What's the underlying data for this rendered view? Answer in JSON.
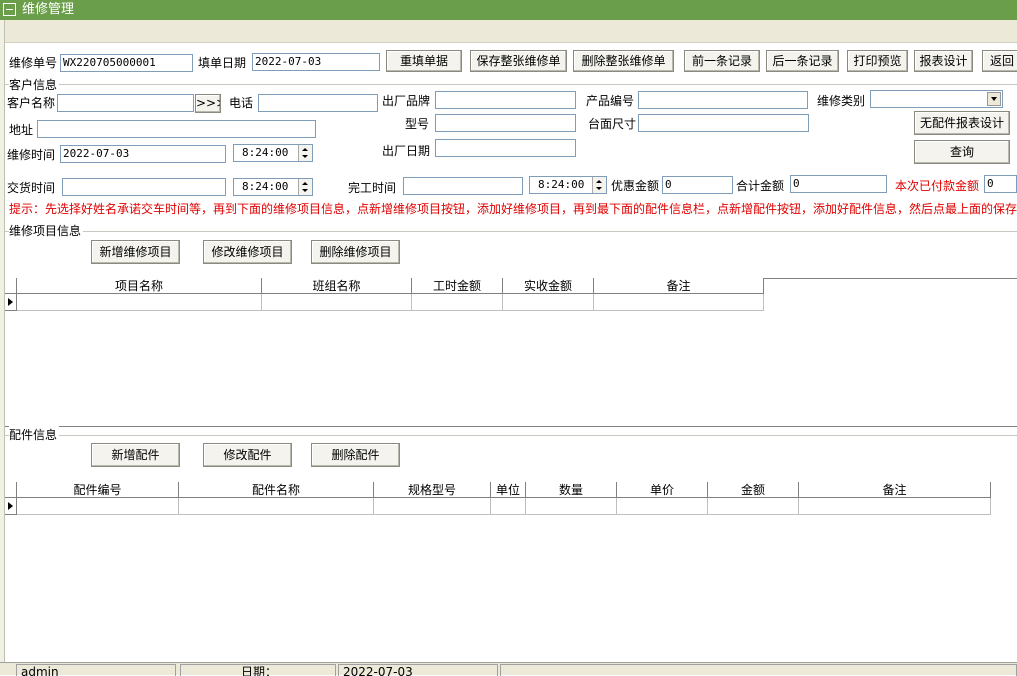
{
  "window": {
    "title": "维修管理"
  },
  "header": {
    "order_no_label": "维修单号",
    "order_no_value": "WX220705000001",
    "fill_date_label": "填单日期",
    "fill_date_value": "2022-07-03",
    "buttons": {
      "reset": "重填单据",
      "save": "保存整张维修单",
      "delete": "删除整张维修单",
      "prev": "前一条记录",
      "next": "后一条记录",
      "print": "打印预览",
      "report": "报表设计",
      "back": "返回"
    }
  },
  "customer": {
    "section": "客户信息",
    "name_label": "客户名称",
    "name_value": "",
    "lookup_button": ">>>",
    "phone_label": "电话",
    "phone_value": "",
    "address_label": "地址",
    "address_value": "",
    "factory_brand_label": "出厂品牌",
    "factory_brand_value": "",
    "model_label": "型号",
    "model_value": "",
    "factory_date_label": "出厂日期",
    "factory_date_value": "",
    "product_no_label": "产品编号",
    "product_no_value": "",
    "table_size_label": "台面尺寸",
    "table_size_value": "",
    "repair_type_label": "维修类别",
    "repair_type_value": "",
    "no_parts_report_button": "无配件报表设计",
    "query_button": "查询",
    "repair_time_label": "维修时间",
    "repair_date_value": "2022-07-03",
    "repair_time_value": "8:24:00",
    "delivery_time_label": "交货时间",
    "delivery_date_value": "",
    "delivery_time_value": "8:24:00",
    "finish_time_label": "完工时间",
    "finish_date_value": "",
    "finish_time_value": "8:24:00",
    "discount_label": "优惠金额",
    "discount_value": "0",
    "total_label": "合计金额",
    "total_value": "0",
    "paid_label": "本次已付款金额",
    "paid_value": "0"
  },
  "hint": "提示：先选择好姓名承诺交车时间等，再到下面的维修项目信息，点新增维修项目按钮，添加好维修项目，再到最下面的配件信息栏，点新增配件按钮，添加好配件信息，然后点最上面的保存按",
  "repair_items": {
    "section": "维修项目信息",
    "add_button": "新增维修项目",
    "edit_button": "修改维修项目",
    "delete_button": "删除维修项目",
    "columns": [
      "项目名称",
      "班组名称",
      "工时金额",
      "实收金额",
      "备注"
    ]
  },
  "parts": {
    "section": "配件信息",
    "add_button": "新增配件",
    "edit_button": "修改配件",
    "delete_button": "删除配件",
    "columns": [
      "配件编号",
      "配件名称",
      "规格型号",
      "单位",
      "数量",
      "单价",
      "金额",
      "备注"
    ]
  },
  "status": {
    "user": "admin",
    "date_label": "日期：",
    "date_value": "2022-07-03"
  },
  "colors": {
    "titlebar": "#6b9e4a",
    "hint_text": "#e00000",
    "panel": "#ece9d8"
  }
}
